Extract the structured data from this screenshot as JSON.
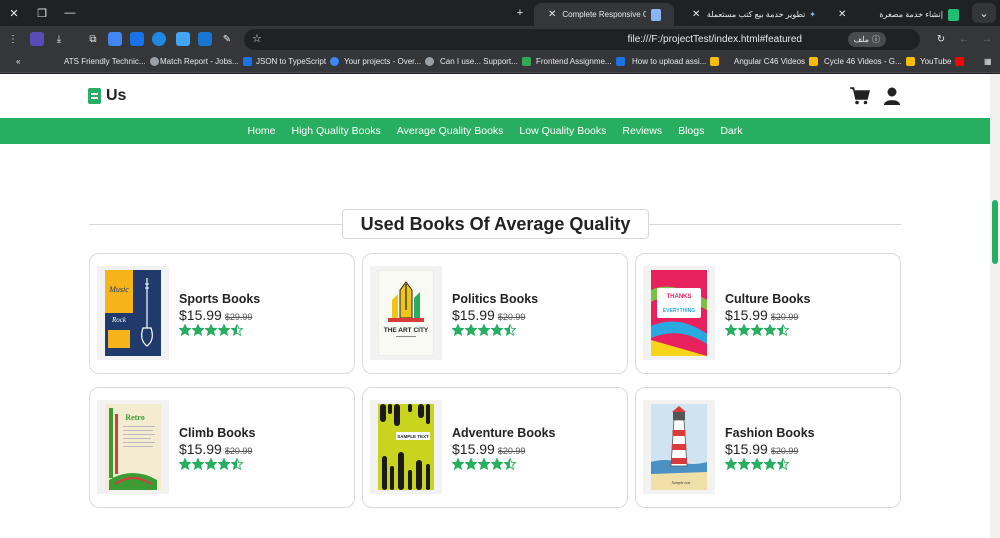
{
  "browser": {
    "tabs": [
      {
        "title": "إنشاء خدمة مصغرة",
        "favicon_color": "#1dbf73"
      },
      {
        "title": "تطوير خدمة بيع كتب مستعملة ع",
        "favicon_color": "#8ab4f8"
      },
      {
        "title": "Complete Responsive Online B",
        "favicon_color": "#8ab4f8"
      }
    ],
    "url": "file:///F:/projectTest/index.html#featured",
    "file_chip": "ملف",
    "bookmarks": [
      {
        "label": "ATS Friendly Technic...",
        "color": "#f9ab00"
      },
      {
        "label": "Match Report - Jobs...",
        "color": "#1a73e8"
      },
      {
        "label": "JSON to TypeScript",
        "color": "#4285f4"
      },
      {
        "label": "Your projects - Over...",
        "color": "#5f6368"
      },
      {
        "label": "Can I use... Support...",
        "color": "#34a853"
      },
      {
        "label": "Frontend Assignme...",
        "color": "#1a73e8"
      },
      {
        "label": "How to upload assi...",
        "color": "#fbbc04"
      },
      {
        "label": "Angular C46 Videos",
        "color": "#fbbc04"
      },
      {
        "label": "Cycle 46 Videos - G...",
        "color": "#fbbc04"
      },
      {
        "label": "YouTube",
        "color": "#ff0000"
      }
    ]
  },
  "site": {
    "logo_text": "Us",
    "nav": [
      "Home",
      "High Quality Books",
      "Average Quality Books",
      "Low Quality Books",
      "Reviews",
      "Blogs",
      "Dark"
    ],
    "section_title": "Used Books Of Average Quality",
    "accent_color": "#27ae60"
  },
  "products": [
    {
      "title": "Sports Books",
      "price": "$15.99",
      "old_price": "$29.99",
      "rating": 4.5,
      "cover": "music"
    },
    {
      "title": "Politics Books",
      "price": "$15.99",
      "old_price": "$20.99",
      "rating": 4.5,
      "cover": "artcity"
    },
    {
      "title": "Culture Books",
      "price": "$15.99",
      "old_price": "$20.99",
      "rating": 4.5,
      "cover": "thanks"
    },
    {
      "title": "Climb Books",
      "price": "$15.99",
      "old_price": "$20.99",
      "rating": 4.5,
      "cover": "retro"
    },
    {
      "title": "Adventure Books",
      "price": "$15.99",
      "old_price": "$20.99",
      "rating": 4.5,
      "cover": "sample"
    },
    {
      "title": "Fashion Books",
      "price": "$15.99",
      "old_price": "$20.99",
      "rating": 4.5,
      "cover": "lighthouse"
    }
  ],
  "cover_text": {
    "music_script": "Music",
    "music_rock": "Rock",
    "artcity_title": "THE ART CITY",
    "thanks_line1": "THANKS",
    "thanks_line2": "EVERYTHING",
    "retro_title": "Retro",
    "sample_text": "SAMPLE TEXT",
    "lighthouse_caption": "Sample text"
  }
}
